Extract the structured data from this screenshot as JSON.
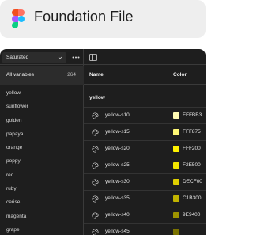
{
  "header": {
    "title": "Foundation File",
    "logo_icon": "figma-logo-icon"
  },
  "toolbar": {
    "mode_select_value": "Saturated",
    "more_icon": "more-icon",
    "sidebar_toggle_icon": "sidebar-toggle-icon"
  },
  "sidebar": {
    "all_variables_label": "All variables",
    "all_variables_count": "264",
    "groups": [
      "yellow",
      "sunflower",
      "golden",
      "papaya",
      "orange",
      "poppy",
      "red",
      "ruby",
      "cerise",
      "magenta",
      "grape"
    ]
  },
  "table": {
    "col_name": "Name",
    "col_color": "Color",
    "section_title": "yellow",
    "rows": [
      {
        "name": "yellow-s10",
        "hex": "FFFBB3",
        "color": "#FFFBB3"
      },
      {
        "name": "yellow-s15",
        "hex": "FFF875",
        "color": "#FFF875"
      },
      {
        "name": "yellow-s20",
        "hex": "FFF200",
        "color": "#FFF200"
      },
      {
        "name": "yellow-s25",
        "hex": "F2E500",
        "color": "#F2E500"
      },
      {
        "name": "yellow-s30",
        "hex": "DECF00",
        "color": "#DECF00"
      },
      {
        "name": "yellow-s35",
        "hex": "C1B300",
        "color": "#C1B300"
      },
      {
        "name": "yellow-s40",
        "hex": "9E9400",
        "color": "#9E9400"
      },
      {
        "name": "yellow-s45",
        "hex": "",
        "color": "#7A7200"
      }
    ]
  },
  "colors": {
    "panel_bg": "#1E1E1E",
    "header_bg": "#EEEEEE",
    "selected_row_bg": "#2C2C2C"
  }
}
